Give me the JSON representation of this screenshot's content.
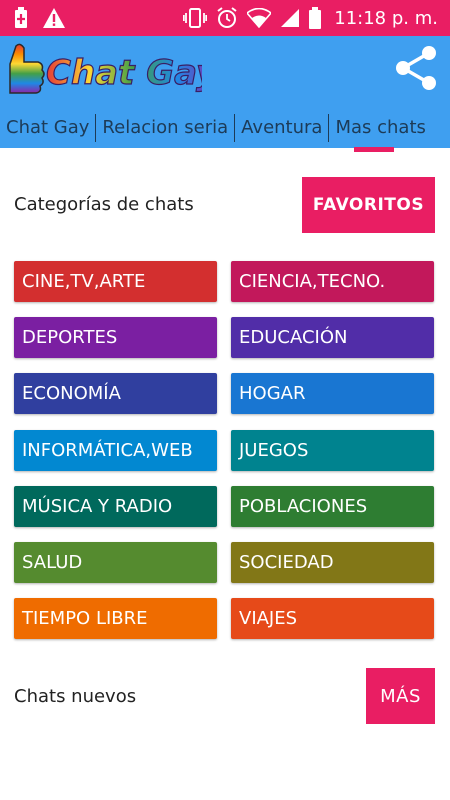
{
  "status_bar": {
    "time": "11:18 p. m."
  },
  "app_bar": {
    "logo_text": "Chat Gay"
  },
  "tabs": [
    {
      "label": "Chat Gay"
    },
    {
      "label": "Relacion seria"
    },
    {
      "label": "Aventura"
    },
    {
      "label": "Mas chats"
    }
  ],
  "categories_section": {
    "label": "Categorías de chats",
    "favorites_button": "FAVORITOS"
  },
  "categories": [
    {
      "label": "CINE,TV,ARTE",
      "color": "#d32f2f"
    },
    {
      "label": "CIENCIA,TECNO.",
      "color": "#c2185b"
    },
    {
      "label": "DEPORTES",
      "color": "#7b1fa2"
    },
    {
      "label": "EDUCACIÓN",
      "color": "#512da8"
    },
    {
      "label": "ECONOMÍA",
      "color": "#303f9f"
    },
    {
      "label": "HOGAR",
      "color": "#1976d2"
    },
    {
      "label": "INFORMÁTICA,WEB",
      "color": "#0288d1"
    },
    {
      "label": "JUEGOS",
      "color": "#00838f"
    },
    {
      "label": "MÚSICA Y RADIO",
      "color": "#00695c"
    },
    {
      "label": "POBLACIONES",
      "color": "#2e7d32"
    },
    {
      "label": "SALUD",
      "color": "#558b2f"
    },
    {
      "label": "SOCIEDAD",
      "color": "#827717"
    },
    {
      "label": "TIEMPO LIBRE",
      "color": "#ef6c00"
    },
    {
      "label": "VIAJES",
      "color": "#e64a19"
    }
  ],
  "new_chats_section": {
    "label": "Chats nuevos",
    "more_button": "MÁS"
  },
  "colors": {
    "status_bar": "#e91e63",
    "app_bar": "#3f9ff0",
    "accent": "#e91e63"
  }
}
